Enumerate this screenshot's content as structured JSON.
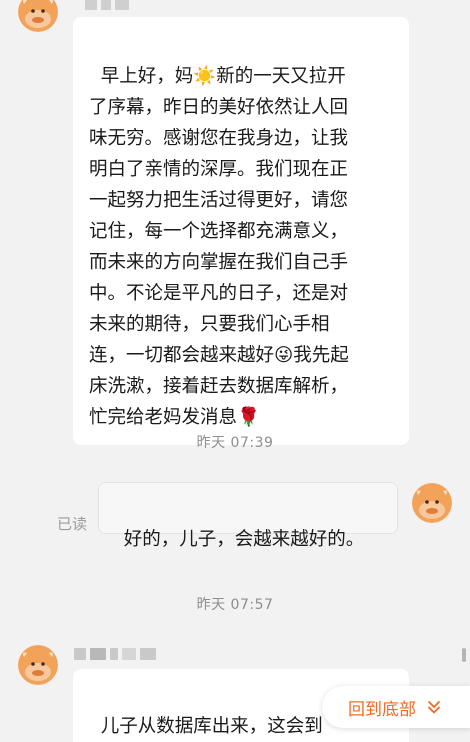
{
  "messages": [
    {
      "from": "mom",
      "text": "早上好，妈☀️新的一天又拉开\n了序幕，昨日的美好依然让人回\n味无穷。感谢您在我身边，让我\n明白了亲情的深厚。我们现在正\n一起努力把生活过得更好，请您\n记住，每一个选择都充满意义，\n而未来的方向掌握在我们自己手\n中。不论是平凡的日子，还是对\n未来的期待，只要我们心手相\n连，一切都会越来越好😜我先起\n床洗漱，接着赶去数据库解析，\n忙完给老妈发消息🌹"
    },
    {
      "timestamp": "昨天  07:39"
    },
    {
      "from": "me",
      "text": "好的，儿子，会越来越好的。",
      "status": "已读"
    },
    {
      "timestamp": "昨天  07:57"
    },
    {
      "from": "mom",
      "text": "儿子从数据库出来，这会到\n了，老妈吃过早饭了没"
    }
  ],
  "back_to_bottom_label": "回到底部",
  "colors": {
    "accent": "#f26a21",
    "background": "#f2f2f2",
    "bubble": "#ffffff"
  },
  "icons": [
    "cow-avatar-icon",
    "chevron-double-down-icon"
  ]
}
